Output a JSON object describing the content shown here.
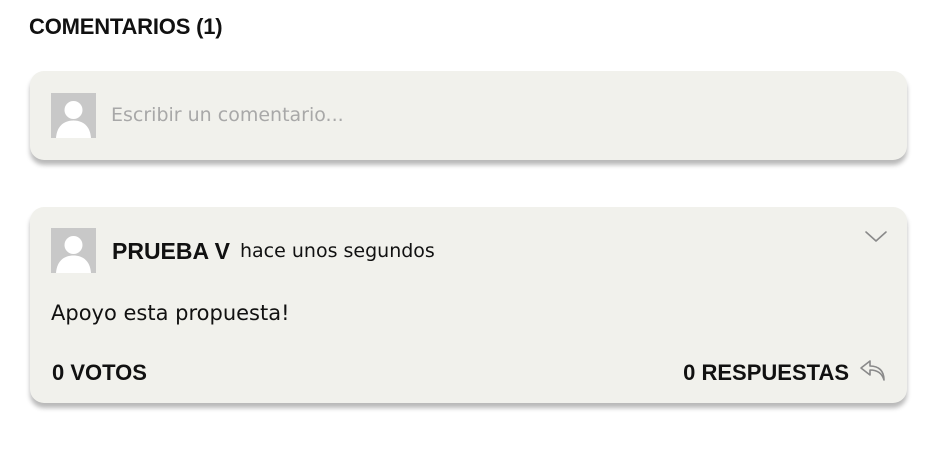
{
  "comments_section": {
    "title": "COMENTARIOS (1)"
  },
  "composer": {
    "placeholder": "Escribir un comentario...",
    "avatar_icon": "user-avatar-icon"
  },
  "comments": [
    {
      "author": "PRUEBA V",
      "time": "hace unos segundos",
      "text": "Apoyo esta propuesta!",
      "votes_label": "0 VOTOS",
      "replies_label": "0 RESPUESTAS",
      "menu_icon": "chevron-down-icon",
      "reply_icon": "reply-icon"
    }
  ],
  "colors": {
    "card_background": "#f1f1ec",
    "avatar_background": "#c8c8c8",
    "text": "#111111",
    "placeholder": "#a8a8a8"
  }
}
